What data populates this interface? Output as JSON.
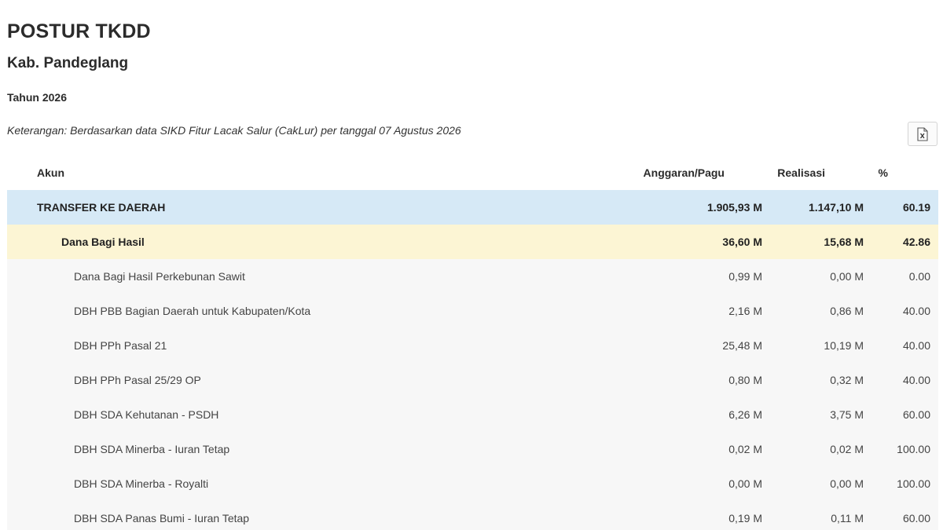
{
  "page": {
    "title": "POSTUR TKDD",
    "region": "Kab. Pandeglang",
    "year": "Tahun 2026",
    "note": "Keterangan: Berdasarkan data SIKD Fitur Lacak Salur (CakLur) per tanggal 07 Agustus 2026"
  },
  "toolbar": {
    "export_icon": "excel-export-icon"
  },
  "table": {
    "headers": {
      "akun": "Akun",
      "pagu": "Anggaran/Pagu",
      "realisasi": "Realisasi",
      "pct": "%"
    },
    "total": {
      "akun": "TRANSFER KE DAERAH",
      "pagu": "1.905,93 M",
      "realisasi": "1.147,10 M",
      "pct": "60.19"
    },
    "group": {
      "akun": "Dana Bagi Hasil",
      "pagu": "36,60 M",
      "realisasi": "15,68 M",
      "pct": "42.86"
    },
    "rows": [
      {
        "akun": "Dana Bagi Hasil Perkebunan Sawit",
        "pagu": "0,99 M",
        "realisasi": "0,00 M",
        "pct": "0.00"
      },
      {
        "akun": "DBH PBB Bagian Daerah untuk Kabupaten/Kota",
        "pagu": "2,16 M",
        "realisasi": "0,86 M",
        "pct": "40.00"
      },
      {
        "akun": "DBH PPh Pasal 21",
        "pagu": "25,48 M",
        "realisasi": "10,19 M",
        "pct": "40.00"
      },
      {
        "akun": "DBH PPh Pasal 25/29 OP",
        "pagu": "0,80 M",
        "realisasi": "0,32 M",
        "pct": "40.00"
      },
      {
        "akun": "DBH SDA Kehutanan - PSDH",
        "pagu": "6,26 M",
        "realisasi": "3,75 M",
        "pct": "60.00"
      },
      {
        "akun": "DBH SDA Minerba - Iuran Tetap",
        "pagu": "0,02 M",
        "realisasi": "0,02 M",
        "pct": "100.00"
      },
      {
        "akun": "DBH SDA Minerba - Royalti",
        "pagu": "0,00 M",
        "realisasi": "0,00 M",
        "pct": "100.00"
      },
      {
        "akun": "DBH SDA Panas Bumi - Iuran Tetap",
        "pagu": "0,19 M",
        "realisasi": "0,11 M",
        "pct": "60.00"
      }
    ]
  },
  "colors": {
    "total_row": "#d6e9f6",
    "group_row": "#fcf5d4",
    "item_row": "#f7f7f7"
  }
}
